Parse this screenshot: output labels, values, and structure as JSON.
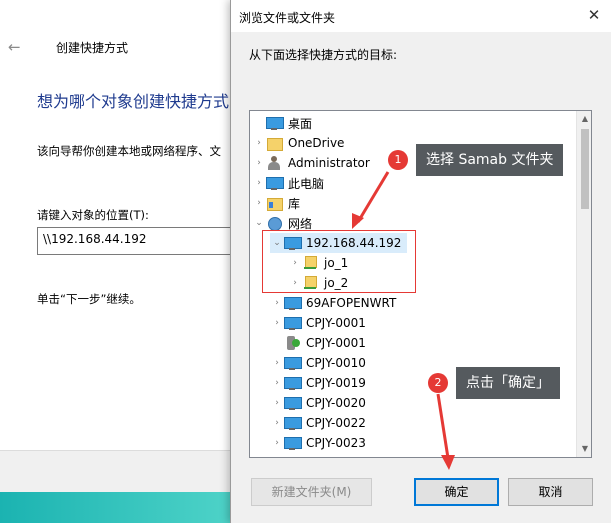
{
  "wizard": {
    "back_icon": "←",
    "title": "创建快捷方式",
    "heading": "想为哪个对象创建快捷方式",
    "description": "该向导帮你创建本地或网络程序、文",
    "location_label": "请键入对象的位置(T):",
    "location_value": "\\\\192.168.44.192",
    "next_hint": "单击“下一步”继续。"
  },
  "dialog": {
    "title": "浏览文件或文件夹",
    "close_icon": "✕",
    "prompt": "从下面选择快捷方式的目标:",
    "tree": [
      {
        "label": "桌面",
        "icon": "monitor-icon",
        "arrow": ""
      },
      {
        "label": "OneDrive",
        "icon": "folder-icon",
        "arrow": "›"
      },
      {
        "label": "Administrator",
        "icon": "user-icon",
        "arrow": "›"
      },
      {
        "label": "此电脑",
        "icon": "monitor-icon",
        "arrow": "›"
      },
      {
        "label": "库",
        "icon": "library-icon",
        "arrow": "›"
      },
      {
        "label": "网络",
        "icon": "network-icon",
        "arrow": "⌄"
      },
      {
        "label": "192.168.44.192",
        "icon": "monitor-icon",
        "arrow": "⌄",
        "selected": true
      },
      {
        "label": "jo_1",
        "icon": "network-folder-icon",
        "arrow": "›"
      },
      {
        "label": "jo_2",
        "icon": "network-folder-icon",
        "arrow": "›"
      },
      {
        "label": "69AFOPENWRT",
        "icon": "monitor-icon",
        "arrow": "›"
      },
      {
        "label": "CPJY-0001",
        "icon": "monitor-icon",
        "arrow": "›"
      },
      {
        "label": "CPJY-0001",
        "icon": "device-icon",
        "arrow": ""
      },
      {
        "label": "CPJY-0010",
        "icon": "monitor-icon",
        "arrow": "›"
      },
      {
        "label": "CPJY-0019",
        "icon": "monitor-icon",
        "arrow": "›"
      },
      {
        "label": "CPJY-0020",
        "icon": "monitor-icon",
        "arrow": "›"
      },
      {
        "label": "CPJY-0022",
        "icon": "monitor-icon",
        "arrow": "›"
      },
      {
        "label": "CPJY-0023",
        "icon": "monitor-icon",
        "arrow": "›"
      }
    ],
    "buttons": {
      "new_folder": "新建文件夹(M)",
      "ok": "确定",
      "cancel": "取消"
    }
  },
  "annotations": {
    "step1_num": "1",
    "step1_text": "选择 Samab 文件夹",
    "step2_num": "2",
    "step2_text": "点击「确定」"
  },
  "colors": {
    "heading": "#1f3b8f",
    "accent_red": "#e53935",
    "selection": "#d9ecfb",
    "ok_border": "#0078d7"
  }
}
